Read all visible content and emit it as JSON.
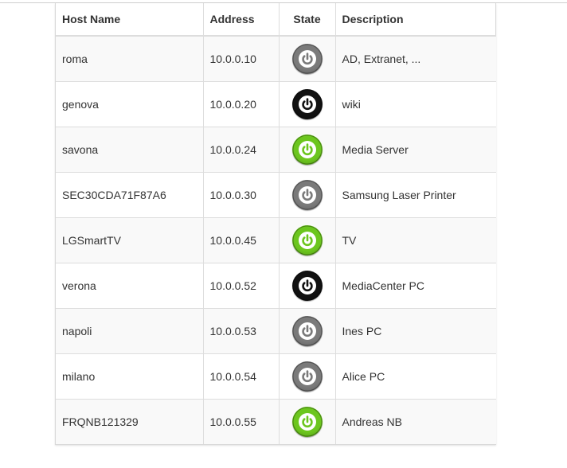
{
  "headers": {
    "host": "Host Name",
    "address": "Address",
    "state": "State",
    "description": "Description"
  },
  "state_colors": {
    "gray": "#7a7a7a",
    "black": "#111111",
    "green": "#6cc61e"
  },
  "hosts": [
    {
      "name": "roma",
      "address": "10.0.0.10",
      "state": "gray",
      "description": "AD, Extranet, ..."
    },
    {
      "name": "genova",
      "address": "10.0.0.20",
      "state": "black",
      "description": "wiki"
    },
    {
      "name": "savona",
      "address": "10.0.0.24",
      "state": "green",
      "description": "Media Server"
    },
    {
      "name": "SEC30CDA71F87A6",
      "address": "10.0.0.30",
      "state": "gray",
      "description": "Samsung Laser Printer"
    },
    {
      "name": "LGSmartTV",
      "address": "10.0.0.45",
      "state": "green",
      "description": "TV"
    },
    {
      "name": "verona",
      "address": "10.0.0.52",
      "state": "black",
      "description": "MediaCenter PC"
    },
    {
      "name": "napoli",
      "address": "10.0.0.53",
      "state": "gray",
      "description": "Ines PC"
    },
    {
      "name": "milano",
      "address": "10.0.0.54",
      "state": "gray",
      "description": "Alice PC"
    },
    {
      "name": "FRQNB121329",
      "address": "10.0.0.55",
      "state": "green",
      "description": "Andreas NB"
    }
  ]
}
